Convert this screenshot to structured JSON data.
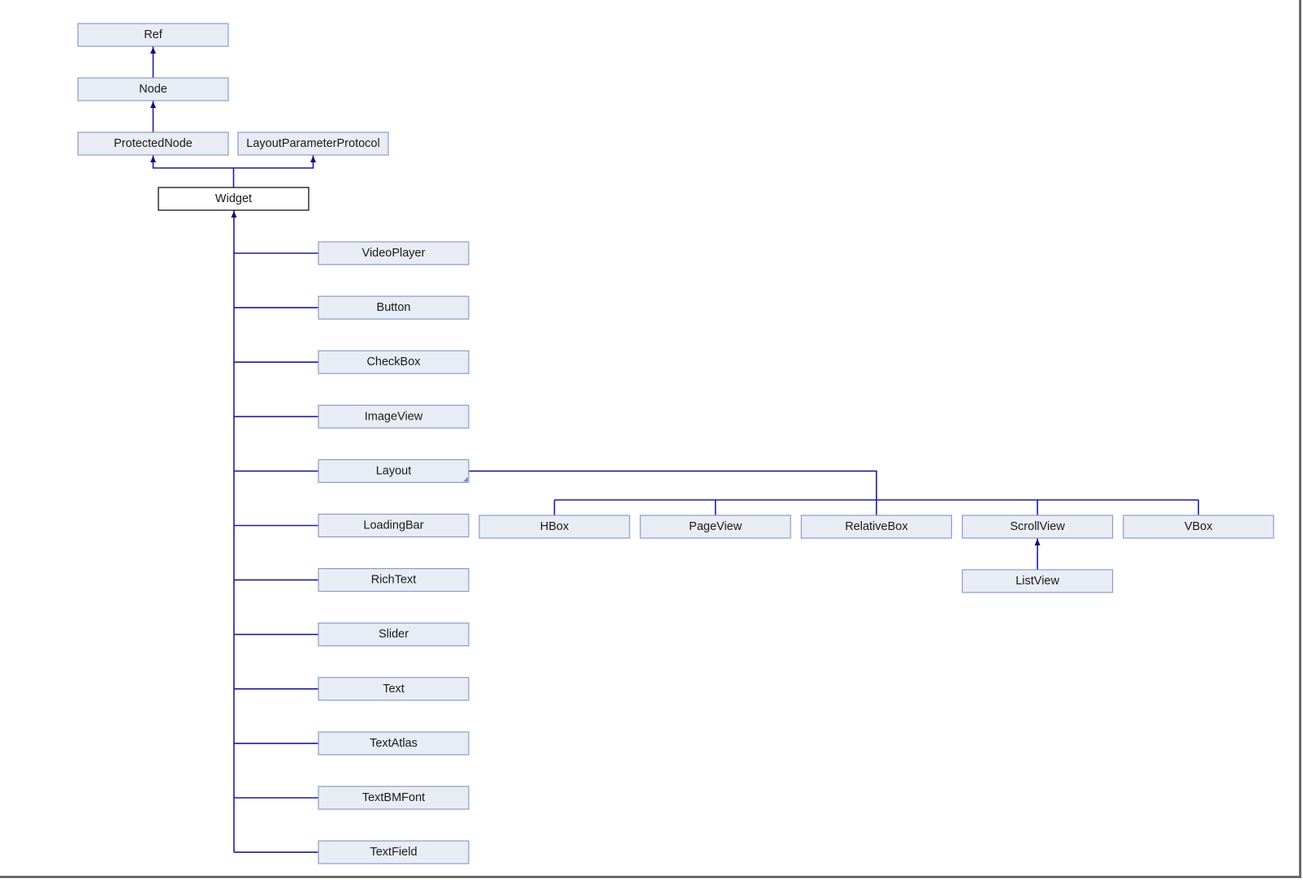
{
  "diagram": {
    "current_class": "Widget",
    "colors": {
      "box_fill": "#e8edf5",
      "box_border": "#8a9cc9",
      "edge": "#1c1c9c",
      "current_border": "#000000"
    },
    "nodes": [
      {
        "id": "Ref",
        "label": "Ref"
      },
      {
        "id": "Node",
        "label": "Node",
        "parent": "Ref"
      },
      {
        "id": "ProtectedNode",
        "label": "ProtectedNode",
        "parent": "Node"
      },
      {
        "id": "LayoutParameterProtocol",
        "label": "LayoutParameterProtocol"
      },
      {
        "id": "Widget",
        "label": "Widget",
        "parents": [
          "ProtectedNode",
          "LayoutParameterProtocol"
        ],
        "current": true
      },
      {
        "id": "VideoPlayer",
        "label": "VideoPlayer",
        "parent": "Widget"
      },
      {
        "id": "Button",
        "label": "Button",
        "parent": "Widget"
      },
      {
        "id": "CheckBox",
        "label": "CheckBox",
        "parent": "Widget"
      },
      {
        "id": "ImageView",
        "label": "ImageView",
        "parent": "Widget"
      },
      {
        "id": "Layout",
        "label": "Layout",
        "parent": "Widget",
        "collapsed_marker": true
      },
      {
        "id": "LoadingBar",
        "label": "LoadingBar",
        "parent": "Widget"
      },
      {
        "id": "RichText",
        "label": "RichText",
        "parent": "Widget"
      },
      {
        "id": "Slider",
        "label": "Slider",
        "parent": "Widget"
      },
      {
        "id": "Text",
        "label": "Text",
        "parent": "Widget"
      },
      {
        "id": "TextAtlas",
        "label": "TextAtlas",
        "parent": "Widget"
      },
      {
        "id": "TextBMFont",
        "label": "TextBMFont",
        "parent": "Widget"
      },
      {
        "id": "TextField",
        "label": "TextField",
        "parent": "Widget"
      },
      {
        "id": "HBox",
        "label": "HBox",
        "parent": "Layout"
      },
      {
        "id": "PageView",
        "label": "PageView",
        "parent": "Layout"
      },
      {
        "id": "RelativeBox",
        "label": "RelativeBox",
        "parent": "Layout"
      },
      {
        "id": "ScrollView",
        "label": "ScrollView",
        "parent": "Layout"
      },
      {
        "id": "VBox",
        "label": "VBox",
        "parent": "Layout"
      },
      {
        "id": "ListView",
        "label": "ListView",
        "parent": "ScrollView"
      }
    ]
  }
}
